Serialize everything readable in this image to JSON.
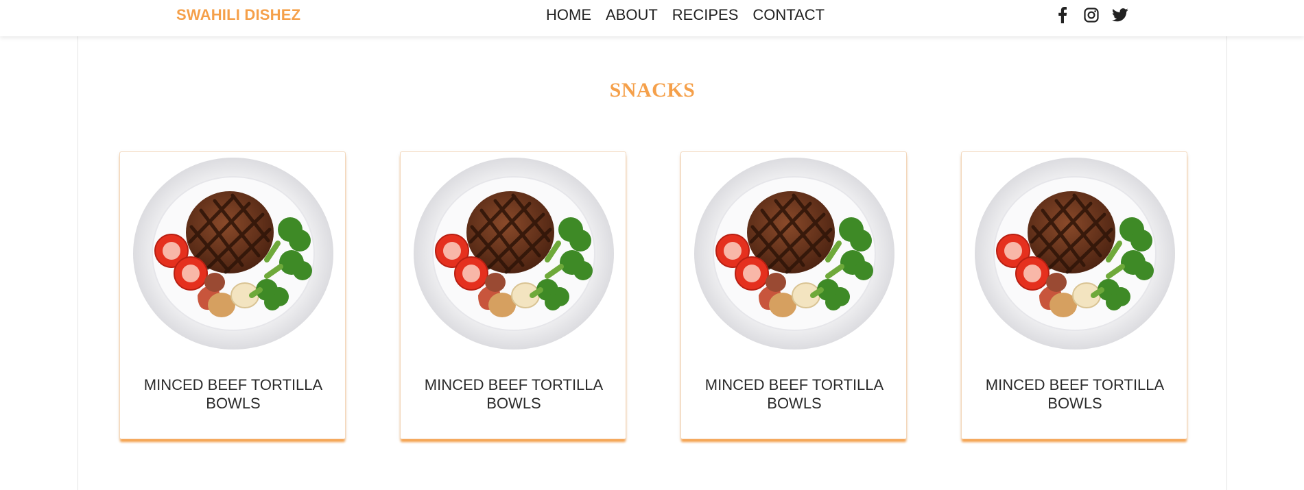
{
  "navbar": {
    "brand": "SWAHILI DISHEZ",
    "links": [
      "HOME",
      "ABOUT",
      "RECIPES",
      "CONTACT"
    ],
    "social_icons": [
      "facebook-icon",
      "instagram-icon",
      "twitter-icon"
    ]
  },
  "section": {
    "title": "SNACKS"
  },
  "cards": [
    {
      "title": "MINCED BEEF TORTILLA BOWLS",
      "image_icon": "grilled-steak-plate"
    },
    {
      "title": "MINCED BEEF TORTILLA BOWLS",
      "image_icon": "grilled-steak-plate"
    },
    {
      "title": "MINCED BEEF TORTILLA BOWLS",
      "image_icon": "grilled-steak-plate"
    },
    {
      "title": "MINCED BEEF TORTILLA BOWLS",
      "image_icon": "grilled-steak-plate"
    }
  ],
  "colors": {
    "accent": "#f5a04a",
    "text": "#222222",
    "background": "#ffffff"
  }
}
